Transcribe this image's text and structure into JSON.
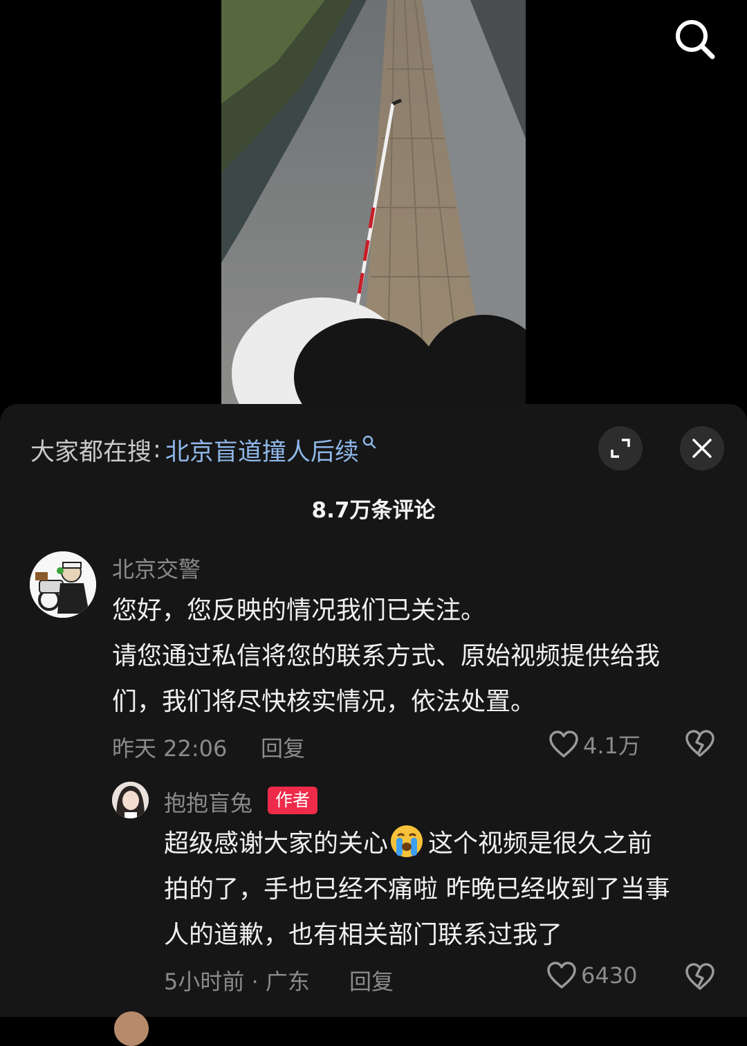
{
  "video": {
    "search_icon": "search-icon"
  },
  "sheet": {
    "hot_search": {
      "prefix": "大家都在搜",
      "colon": ":",
      "term": "北京盲道撞人后续",
      "term_icon": "mini-search-icon"
    },
    "expand_icon": "expand-icon",
    "close_icon": "close-icon",
    "comment_count": "8.7万条评论"
  },
  "comments": [
    {
      "username": "北京交警",
      "text_lines": [
        "您好，您反映的情况我们已关注。",
        "请您通过私信将您的联系方式、原始视频提供给我",
        "们，我们将尽快核实情况，依法处置。"
      ],
      "time": "昨天 22:06",
      "reply_label": "回复",
      "likes": "4.1万",
      "replies": [
        {
          "username": "抱抱盲兔",
          "badge": "作者",
          "text_lines": [
            "超级感谢大家的关心",
            "这个视频是很久之前",
            "拍的了，手也已经不痛啦 昨晚已经收到了当事",
            "人的道歉，也有相关部门联系过我了"
          ],
          "emoji": "loudly-crying-face",
          "time": "5小时前 · 广东",
          "reply_label": "回复",
          "likes": "6430"
        }
      ]
    }
  ],
  "colors": {
    "sheet_bg": "#161616",
    "link_blue": "#8fb8ea",
    "meta_gray": "#8b8b8b",
    "badge_red": "#ee2b4a"
  }
}
